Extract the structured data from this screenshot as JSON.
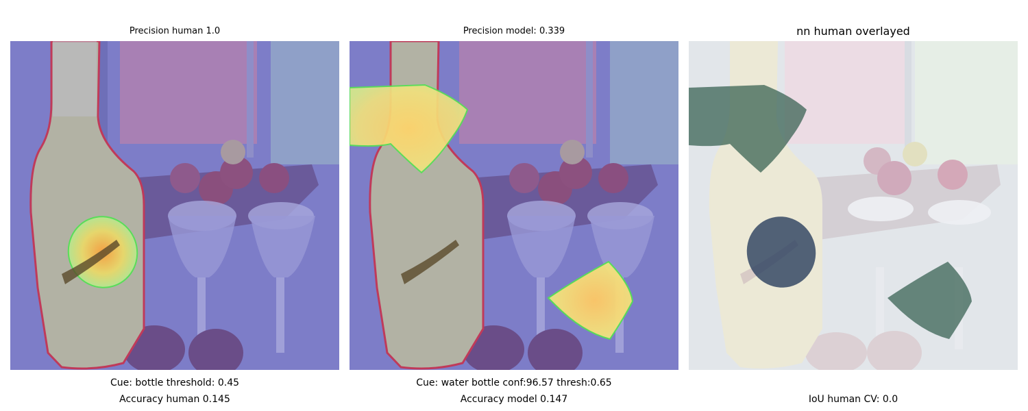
{
  "panels": [
    {
      "title": "Precision human 1.0",
      "caption1": "Cue: bottle threshold: 0.45",
      "caption2": "Accuracy human 0.145"
    },
    {
      "title": "Precision model: 0.339",
      "caption1": "Cue: water bottle conf:96.57 thresh:0.65",
      "caption2": "Accuracy model 0.147"
    },
    {
      "title": "nn human overlayed",
      "caption1": "",
      "caption2": "IoU human CV: 0.0"
    }
  ],
  "colors": {
    "overlay_blue": "#7b7bd0",
    "human_outline": "#c03a5a",
    "model_outline": "#55e055",
    "heat_yellow": "#f7e27a",
    "nn_region": "#2f5a4a"
  }
}
